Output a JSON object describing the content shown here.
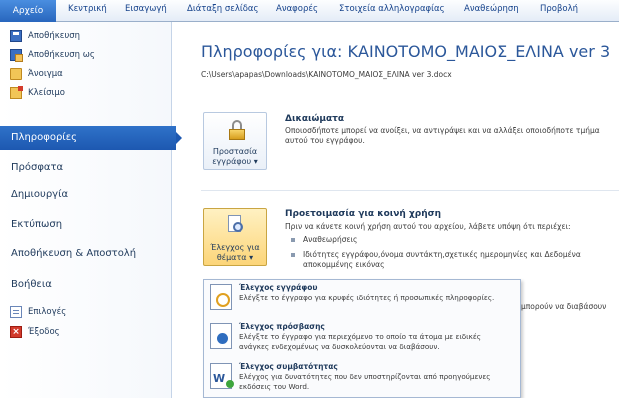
{
  "ribbon": {
    "tabs": [
      "Αρχείο",
      "Κεντρική",
      "Εισαγωγή",
      "Διάταξη σελίδας",
      "Αναφορές",
      "Στοιχεία αλληλογραφίας",
      "Αναθεώρηση",
      "Προβολή"
    ]
  },
  "nav": {
    "commands": {
      "save": "Αποθήκευση",
      "save_as": "Αποθήκευση ως",
      "open": "Άνοιγμα",
      "close": "Κλείσιμο",
      "options": "Επιλογές",
      "exit": "Έξοδος"
    },
    "items": {
      "info": "Πληροφορίες",
      "recent": "Πρόσφατα",
      "new": "Δημιουργία",
      "print": "Εκτύπωση",
      "save_send": "Αποθήκευση & Αποστολή",
      "help": "Βοήθεια"
    }
  },
  "main": {
    "title": "Πληροφορίες για: ΚΑΙΝΟΤΟΜΟ_ΜΑΙΟΣ_ΕΛΙΝΑ ver 3",
    "path": "C:\\Users\\apapas\\Downloads\\ΚΑΙΝΟΤΟΜΟ_ΜΑΙΟΣ_ΕΛΙΝΑ ver 3.docx",
    "permissions": {
      "button_line1": "Προστασία",
      "button_line2": "εγγράφου ▾",
      "heading": "Δικαιώματα",
      "text": "Οποιοσδήποτε μπορεί να ανοίξει, να αντιγράψει και να αλλάξει οποιοδήποτε τμήμα αυτού του εγγράφου."
    },
    "prepare": {
      "button_line1": "Έλεγχος για",
      "button_line2": "θέματα ▾",
      "heading": "Προετοιμασία για κοινή χρήση",
      "text": "Πριν να κάνετε κοινή χρήση αυτού του αρχείου, λάβετε υπόψη ότι περιέχει:",
      "bullet1": "Αναθεωρήσεις",
      "bullet2_line1": "Ιδιότητες εγγράφου,όνομα συντάκτη,σχετικές ημερομηνίες και Δεδομένα",
      "bullet2_line2": "αποκομμένης εικόνας"
    },
    "partial_text": "μπορούν να διαβάσουν"
  },
  "dropdown": {
    "inspect": {
      "title": "Έλεγχος εγγράφου",
      "desc": "Ελέγξτε το έγγραφο για κρυφές ιδιότητες ή προσωπικές πληροφορίες."
    },
    "accessibility": {
      "title": "Έλεγχος πρόσβασης",
      "desc": "Ελέγξτε το έγγραφο για περιεχόμενο το οποίο τα άτομα με ειδικές ανάγκες ενδεχομένως να δυσκολεύονται να διαβάσουν."
    },
    "compatibility": {
      "title": "Έλεγχος συμβατότητας",
      "desc": "Ελέγχος για δυνατότητες που δεν υποστηρίζονται από προηγούμενες εκδόσεις του Word."
    }
  }
}
